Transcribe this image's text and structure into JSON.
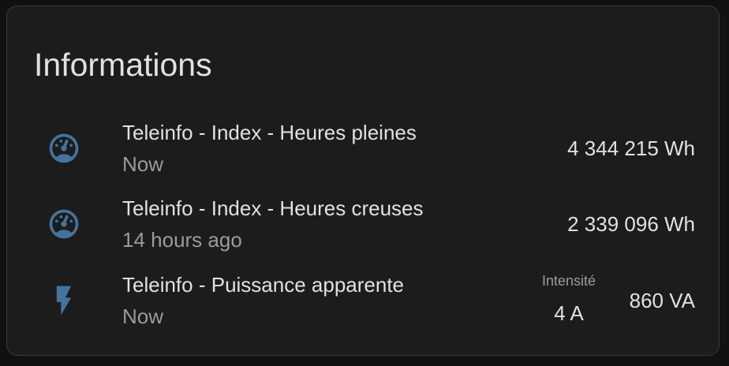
{
  "card": {
    "title": "Informations",
    "icon_color": "#44739e"
  },
  "entities": [
    {
      "icon": "gauge-icon",
      "name": "Teleinfo - Index - Heures pleines",
      "last_changed": "Now",
      "state": "4 344 215 Wh"
    },
    {
      "icon": "gauge-icon",
      "name": "Teleinfo - Index - Heures creuses",
      "last_changed": "14 hours ago",
      "state": "2 339 096 Wh"
    },
    {
      "icon": "flash-icon",
      "name": "Teleinfo - Puissance apparente",
      "last_changed": "Now",
      "attribute": {
        "label": "Intensité",
        "value": "4 A"
      },
      "state": "860 VA"
    }
  ]
}
